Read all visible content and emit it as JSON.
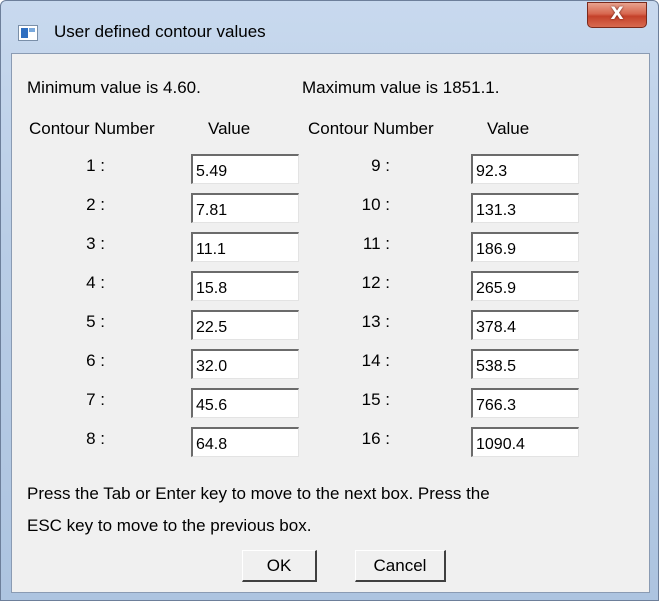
{
  "window": {
    "title": "User defined contour values",
    "close_label": "X"
  },
  "info": {
    "min_text": "Minimum value is 4.60.",
    "max_text": "Maximum value is 1851.1."
  },
  "headers": {
    "contour_number": "Contour Number",
    "value": "Value"
  },
  "contours": [
    {
      "label": "1 :",
      "value": "5.49"
    },
    {
      "label": "2 :",
      "value": "7.81"
    },
    {
      "label": "3 :",
      "value": "11.1"
    },
    {
      "label": "4 :",
      "value": "15.8"
    },
    {
      "label": "5 :",
      "value": "22.5"
    },
    {
      "label": "6 :",
      "value": "32.0"
    },
    {
      "label": "7 :",
      "value": "45.6"
    },
    {
      "label": "8 :",
      "value": "64.8"
    },
    {
      "label": "9 :",
      "value": "92.3"
    },
    {
      "label": "10 :",
      "value": "131.3"
    },
    {
      "label": "11 :",
      "value": "186.9"
    },
    {
      "label": "12 :",
      "value": "265.9"
    },
    {
      "label": "13 :",
      "value": "378.4"
    },
    {
      "label": "14 :",
      "value": "538.5"
    },
    {
      "label": "15 :",
      "value": "766.3"
    },
    {
      "label": "16 :",
      "value": "1090.4"
    }
  ],
  "instructions": {
    "line1": "Press the Tab or Enter key to move to the next box. Press the",
    "line2": "ESC key to move to the previous box."
  },
  "buttons": {
    "ok": "OK",
    "cancel": "Cancel"
  }
}
